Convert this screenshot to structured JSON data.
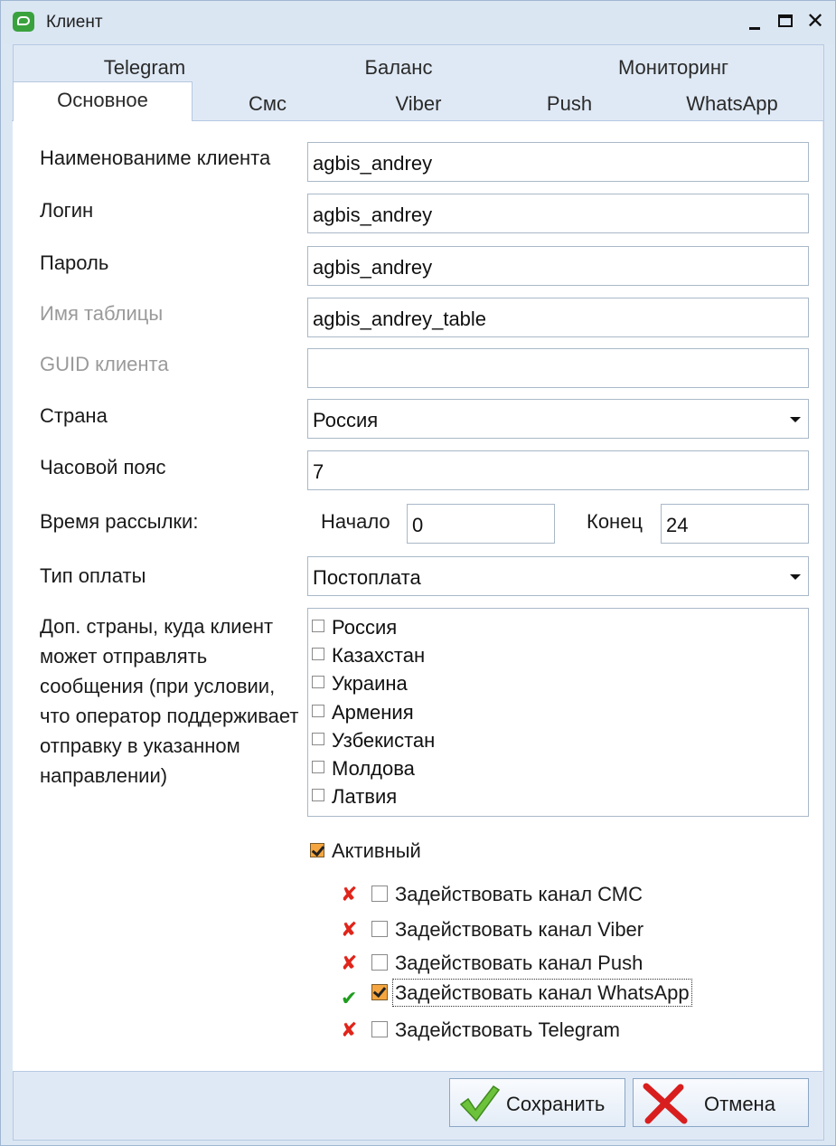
{
  "window": {
    "title": "Клиент"
  },
  "tabs": {
    "row1": [
      "Telegram",
      "Баланс",
      "Мониторинг"
    ],
    "row2": [
      "Основное",
      "Смс",
      "Viber",
      "Push",
      "WhatsApp"
    ],
    "active": "Основное"
  },
  "form": {
    "client_name": {
      "label": "Наименованиме клиента",
      "value": "agbis_andrey"
    },
    "login": {
      "label": "Логин",
      "value": "agbis_andrey"
    },
    "password": {
      "label": "Пароль",
      "value": "agbis_andrey"
    },
    "table_name": {
      "label": "Имя таблицы",
      "value": "agbis_andrey_table"
    },
    "guid": {
      "label": "GUID клиента",
      "value": ""
    },
    "country": {
      "label": "Страна",
      "value": "Россия"
    },
    "timezone": {
      "label": "Часовой пояс",
      "value": "7"
    },
    "send_time": {
      "label": "Время рассылки:",
      "start_label": "Начало",
      "start": "0",
      "end_label": "Конец",
      "end": "24"
    },
    "payment": {
      "label": "Тип оплаты",
      "value": "Постоплата"
    },
    "extra_countries": {
      "label": "Доп. страны, куда клиент может отправлять сообщения (при условии, что оператор поддерживает отправку в указанном направлении)",
      "items": [
        "Россия",
        "Казахстан",
        "Украина",
        "Армения",
        "Узбекистан",
        "Молдова",
        "Латвия"
      ]
    },
    "active": {
      "label": "Активный",
      "checked": true
    },
    "channels": [
      {
        "label": "Задействовать канал СМС",
        "checked": false,
        "status_icon": "red-x-icon"
      },
      {
        "label": "Задействовать канал Viber",
        "checked": false,
        "status_icon": "red-x-icon"
      },
      {
        "label": "Задействовать канал Push",
        "checked": false,
        "status_icon": "red-x-icon"
      },
      {
        "label": "Задействовать канал WhatsApp",
        "checked": true,
        "status_icon": "green-check-icon"
      },
      {
        "label": "Задействовать Telegram",
        "checked": false,
        "status_icon": "red-x-icon"
      }
    ]
  },
  "buttons": {
    "save": "Сохранить",
    "cancel": "Отмена"
  },
  "colors": {
    "frame": "#dce7f4",
    "checkbox_checked": "#f6a640",
    "status_off": "#e0251b",
    "status_on": "#1f9d1f"
  }
}
